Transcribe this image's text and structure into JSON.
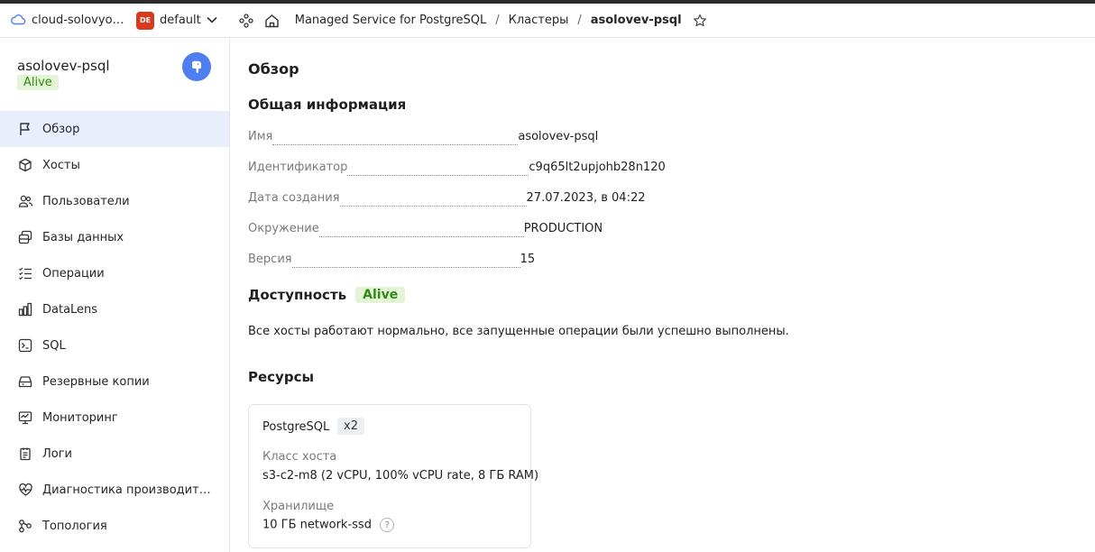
{
  "header": {
    "cloud_name": "cloud-solovyov...",
    "folder_badge": "DE",
    "folder_name": "default",
    "breadcrumbs": [
      "Managed Service for PostgreSQL",
      "Кластеры",
      "asolovev-psql"
    ],
    "separator": "/"
  },
  "sidebar": {
    "cluster_name": "asolovev-psql",
    "status": "Alive",
    "items": [
      {
        "label": "Обзор",
        "icon": "flag-icon",
        "active": true
      },
      {
        "label": "Хосты",
        "icon": "cube-icon"
      },
      {
        "label": "Пользователи",
        "icon": "users-icon"
      },
      {
        "label": "Базы данных",
        "icon": "databases-icon"
      },
      {
        "label": "Операции",
        "icon": "list-check-icon"
      },
      {
        "label": "DataLens",
        "icon": "bar-chart-icon"
      },
      {
        "label": "SQL",
        "icon": "terminal-icon"
      },
      {
        "label": "Резервные копии",
        "icon": "backup-icon"
      },
      {
        "label": "Мониторинг",
        "icon": "monitor-icon"
      },
      {
        "label": "Логи",
        "icon": "logs-icon"
      },
      {
        "label": "Диагностика производитель...",
        "icon": "heartbeat-icon"
      },
      {
        "label": "Топология",
        "icon": "topology-icon"
      }
    ]
  },
  "main": {
    "title": "Обзор",
    "general_title": "Общая информация",
    "info": [
      {
        "key": "Имя",
        "value": "asolovev-psql"
      },
      {
        "key": "Идентификатор",
        "value": "c9q65lt2upjohb28n120"
      },
      {
        "key": "Дата создания",
        "value": "27.07.2023, в 04:22"
      },
      {
        "key": "Окружение",
        "value": "PRODUCTION"
      },
      {
        "key": "Версия",
        "value": "15"
      }
    ],
    "availability_title": "Доступность",
    "availability_status": "Alive",
    "availability_text": "Все хосты работают нормально, все запущенные операции были успешно выполнены.",
    "resources_title": "Ресурсы",
    "resources": {
      "name": "PostgreSQL",
      "count": "x2",
      "host_class_label": "Класс хоста",
      "host_class_value": "s3-c2-m8 (2 vCPU, 100% vCPU rate, 8 ГБ RAM)",
      "storage_label": "Хранилище",
      "storage_size": "10 ГБ",
      "storage_type": "network-ssd",
      "help": "?"
    }
  },
  "colors": {
    "accent": "#4f7ef0",
    "alive_bg": "#e3f4d7",
    "alive_text": "#2e8a12",
    "active_nav": "#e9eefc",
    "folder_badge": "#d93a1c"
  }
}
